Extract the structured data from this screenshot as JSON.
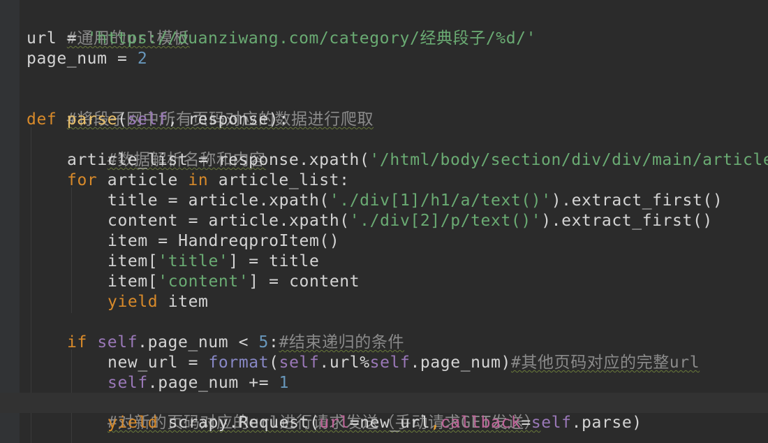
{
  "editor": {
    "lines": [
      {
        "comment": "#通用的url模板"
      },
      {
        "a": "url = ",
        "b": "'https://duanziwang.com/category/经典段子/%d/'"
      },
      {
        "a": "page_num = ",
        "b": "2"
      },
      {
        "a": ""
      },
      {
        "comment": "#将段子网中所有页码对应的数据进行爬取"
      },
      {
        "kw": "def ",
        "fn": "parse",
        "p1": "(",
        "self": "self",
        "p2": ", response):"
      },
      {
        "comment": "#数据解析名称和内容"
      },
      {
        "a": "article_list = response.xpath(",
        "b": "'/html/body/section/div/div/main/article'"
      },
      {
        "kw1": "for",
        "a": " article ",
        "kw2": "in",
        "b": " article_list:"
      },
      {
        "a": "title = article.xpath(",
        "b": "'./div[1]/h1/a/text()'",
        "c": ").extract_first()"
      },
      {
        "a": "content = article.xpath(",
        "b": "'./div[2]/p/text()'",
        "c": ").extract_first()"
      },
      {
        "a": "item = HandreqproItem()"
      },
      {
        "a": "item[",
        "b": "'title'",
        "c": "] = title"
      },
      {
        "a": "item[",
        "b": "'content'",
        "c": "] = content"
      },
      {
        "kw": "yield",
        "a": " item"
      },
      {
        "kw": "if",
        "self": " self",
        "a": ".page_num < ",
        "n": "5",
        "b": ":",
        "comment": "#结束递归的条件"
      },
      {
        "a": "new_url = ",
        "builtin": "format",
        "b": "(",
        "self1": "self",
        "c": ".url%",
        "self2": "self",
        "d": ".page_num)",
        "comment": "#其他页码对应的完整url"
      },
      {
        "self": "self",
        "a": ".page_num += ",
        "n": "1"
      },
      {
        "comment": "#对新的页码对应的url进行请求发送（手动请求GET发送）"
      },
      {
        "kw": "yield",
        "a": " scrapy.Request(",
        "k1": "url",
        "b": "=new_url",
        "dot": ",",
        "k2": "callback",
        "c": "=",
        "self": "self",
        "d": ".parse)"
      }
    ]
  }
}
